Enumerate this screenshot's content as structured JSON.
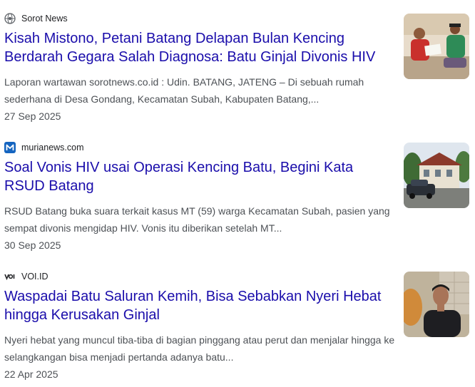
{
  "results": [
    {
      "source": "Sorot News",
      "favicon": "sorotnews-globe-icon",
      "headline": "Kisah Mistono, Petani Batang Delapan Bulan Kencing Berdarah Gegara Salah Diagnosa: Batu Ginjal Divonis HIV",
      "snippet": "Laporan wartawan sorotnews.co.id : Udin. BATANG, JATENG – Di sebuah rumah sederhana di Desa Gondang, Kecamatan Subah, Kabupaten Batang,...",
      "date": "27 Sep 2025",
      "thumbnail": "photo-two-men-reading-document"
    },
    {
      "source": "murianews.com",
      "favicon": "murianews-m-icon",
      "headline": "Soal Vonis HIV usai Operasi Kencing Batu, Begini Kata RSUD Batang",
      "snippet": "RSUD Batang buka suara terkait kasus MT (59) warga Kecamatan Subah, pasien yang sempat divonis mengidap HIV. Vonis itu diberikan setelah MT...",
      "date": "30 Sep 2025",
      "thumbnail": "photo-hospital-building-with-car"
    },
    {
      "source": "VOI.ID",
      "favicon": "voi-logo-icon",
      "headline": "Waspadai Batu Saluran Kemih, Bisa Sebabkan Nyeri Hebat hingga Kerusakan Ginjal",
      "snippet": "Nyeri hebat yang muncul tiba-tiba di bagian pinggang atau perut dan menjalar hingga ke selangkangan bisa menjadi pertanda adanya batu...",
      "date": "22 Apr 2025",
      "thumbnail": "photo-man-portrait"
    }
  ],
  "colors": {
    "headline": "#1a0dab",
    "snippet": "#4d5156",
    "source": "#202124",
    "murianews_brand": "#1565c0"
  }
}
